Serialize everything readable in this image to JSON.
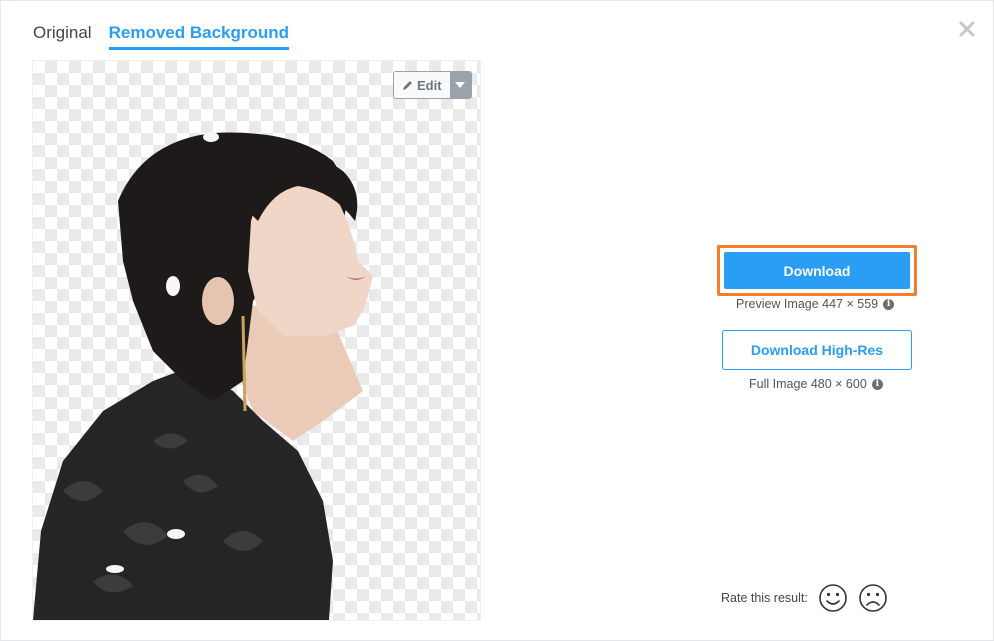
{
  "tabs": [
    {
      "label": "Original",
      "active": false
    },
    {
      "label": "Removed Background",
      "active": true
    }
  ],
  "image": {
    "edit_label": "Edit"
  },
  "actions": {
    "download_label": "Download",
    "preview_info": "Preview Image 447 × 559",
    "hires_label": "Download High-Res",
    "full_info": "Full Image 480 × 600"
  },
  "rating": {
    "label": "Rate this result:"
  },
  "icons": {
    "close": "close-icon",
    "edit": "pencil-icon",
    "caret": "caret-down-icon",
    "info": "info-icon",
    "happy": "smiley-icon",
    "sad": "frowny-icon"
  },
  "colors": {
    "accent": "#2a9df4",
    "highlight_border": "#f47c2c"
  }
}
